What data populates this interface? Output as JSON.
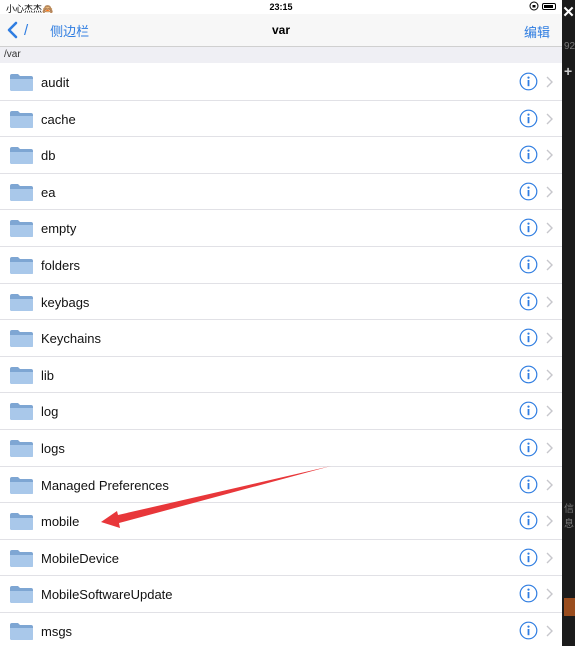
{
  "status": {
    "carrier": "小心杰杰🙈",
    "time": "23:15"
  },
  "nav": {
    "back_label": "侧边栏",
    "back_divider": "/",
    "title": "var",
    "edit_label": "编辑"
  },
  "path": "/var",
  "files": [
    {
      "name": "audit"
    },
    {
      "name": "cache"
    },
    {
      "name": "db"
    },
    {
      "name": "ea"
    },
    {
      "name": "empty"
    },
    {
      "name": "folders"
    },
    {
      "name": "keybags"
    },
    {
      "name": "Keychains"
    },
    {
      "name": "lib"
    },
    {
      "name": "log"
    },
    {
      "name": "logs"
    },
    {
      "name": "Managed Preferences"
    },
    {
      "name": "mobile"
    },
    {
      "name": "MobileDevice"
    },
    {
      "name": "MobileSoftwareUpdate"
    },
    {
      "name": "msgs"
    }
  ],
  "side": {
    "close_glyph": "✕",
    "plus_glyph": "+",
    "text_fragment_1": "92",
    "text_fragment_2": "信息"
  },
  "colors": {
    "accent": "#2f7de1",
    "folder": "#8fb4dc",
    "annotation_arrow": "#e8373a"
  },
  "icons": {
    "back": "chevron-left-icon",
    "folder": "folder-icon",
    "info": "info-circle-icon",
    "disclosure": "chevron-right-icon"
  },
  "annotation": {
    "type": "red-arrow",
    "points_to": "mobile"
  }
}
